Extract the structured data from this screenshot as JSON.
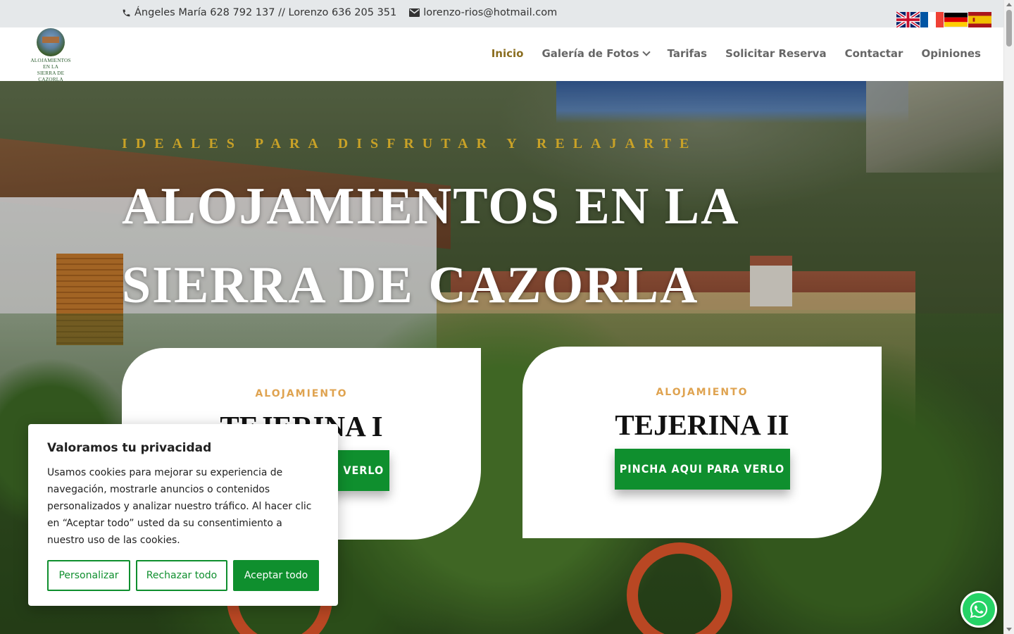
{
  "topbar": {
    "phone": "Ángeles María 628 792 137 // Lorenzo 636 205 351",
    "email": "lorenzo-rios@hotmail.com",
    "languages": [
      "English",
      "Français",
      "Deutsch",
      "Español"
    ]
  },
  "logo": {
    "line1": "ALOJAMIENTOS",
    "line2": "EN LA",
    "line3": "SIERRA DE CAZORLA"
  },
  "nav": {
    "items": [
      {
        "label": "Inicio",
        "active": true
      },
      {
        "label": "Galería de Fotos",
        "has_dropdown": true
      },
      {
        "label": "Tarifas"
      },
      {
        "label": "Solicitar Reserva"
      },
      {
        "label": "Contactar"
      },
      {
        "label": "Opiniones"
      }
    ]
  },
  "hero": {
    "tagline": "IDEALES PARA DISFRUTAR Y RELAJARTE",
    "title": "ALOJAMIENTOS EN LA SIERRA DE CAZORLA"
  },
  "cards": [
    {
      "kicker": "ALOJAMIENTO",
      "name": "TEJERINA I",
      "button": "PINCHA AQUI PARA VERLO"
    },
    {
      "kicker": "ALOJAMIENTO",
      "name": "TEJERINA II",
      "button": "PINCHA AQUI PARA VERLO"
    }
  ],
  "cookie": {
    "title": "Valoramos tu privacidad",
    "body": "Usamos cookies para mejorar su experiencia de navegación, mostrarle anuncios o contenidos personalizados y analizar nuestro tráfico. Al hacer clic en “Aceptar todo” usted da su consentimiento a nuestro uso de las cookies.",
    "customize": "Personalizar",
    "reject": "Rechazar todo",
    "accept": "Aceptar todo"
  },
  "colors": {
    "accent_gold": "#c9a227",
    "nav_active": "#8a6d1f",
    "button_green": "#0f8f2e",
    "kicker_orange": "#dfa350",
    "whatsapp_green": "#25d366"
  },
  "icons": {
    "phone": "phone-icon",
    "email": "envelope-icon",
    "whatsapp": "whatsapp-icon"
  }
}
